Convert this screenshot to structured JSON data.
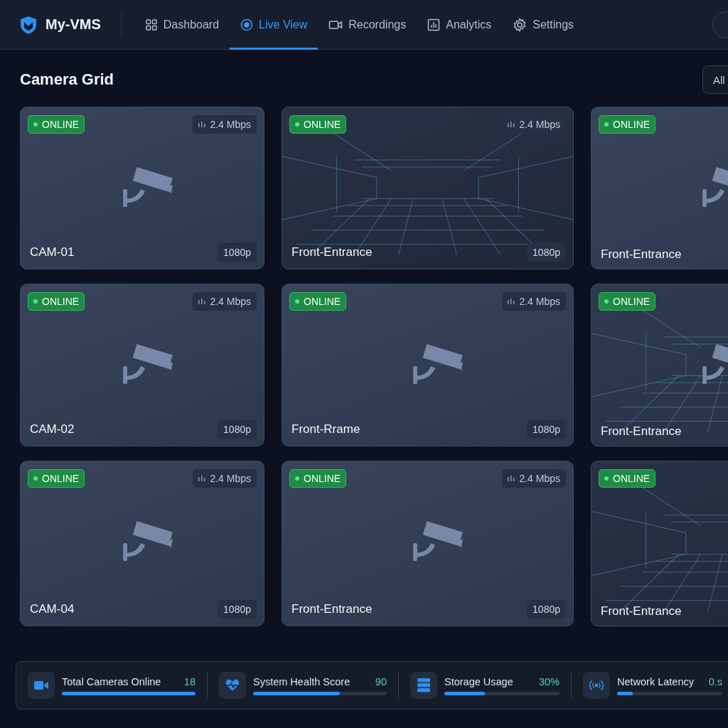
{
  "app": {
    "name": "My-VMS"
  },
  "nav": [
    {
      "label": "Dashboard",
      "kind": "grid",
      "selected": false
    },
    {
      "label": "Live View",
      "kind": "live",
      "selected": true
    },
    {
      "label": "Recordings",
      "kind": "video",
      "selected": false
    },
    {
      "label": "Analytics",
      "kind": "chart",
      "selected": false
    },
    {
      "label": "Settings",
      "kind": "gear",
      "selected": false
    }
  ],
  "page": {
    "title": "Camera Grid",
    "filter": "All"
  },
  "cameras": [
    {
      "name": "CAM-01",
      "status": "ONLINE",
      "online": true,
      "bitrate": "2.4 Mbps",
      "resolution": "1080p",
      "kind": "camera"
    },
    {
      "name": "Front-Entrance",
      "status": "ONLINE",
      "online": true,
      "bitrate": "2.4 Mbps",
      "resolution": "1080p",
      "kind": "grid"
    },
    {
      "name": "Front-Entrance",
      "status": "ONLINE",
      "online": true,
      "kind": "camera"
    },
    {
      "name": "CAM-02",
      "status": "ONLINE",
      "online": true,
      "bitrate": "2.4 Mbps",
      "resolution": "1080p",
      "kind": "camera"
    },
    {
      "name": "Front-Rrame",
      "status": "ONLINE",
      "online": true,
      "bitrate": "2.4 Mbps",
      "resolution": "1080p",
      "kind": "camera"
    },
    {
      "name": "Front-Entrance",
      "status": "ONLINE",
      "online": true,
      "kind": "mixed"
    },
    {
      "name": "CAM-04",
      "status": "ONLINE",
      "online": true,
      "bitrate": "2.4 Mbps",
      "resolution": "1080p",
      "kind": "camera"
    },
    {
      "name": "Front-Entrance",
      "status": "ONLINE",
      "online": true,
      "bitrate": "2.4 Mbps",
      "resolution": "1080p",
      "kind": "camera"
    },
    {
      "name": "Front-Entrance",
      "status": "ONLINE",
      "online": true,
      "kind": "grid"
    }
  ],
  "stats": [
    {
      "label": "Total Cameras Online",
      "value": "18",
      "kind": "video",
      "level": 1.0
    },
    {
      "label": "System Health Score",
      "value": "90",
      "kind": "heart",
      "level": 0.65
    },
    {
      "label": "Storage Usage",
      "value": "30%",
      "kind": "server",
      "level": 0.35
    },
    {
      "label": "Network Latency",
      "value": "0.s",
      "kind": "signal",
      "level": 0.15
    }
  ]
}
